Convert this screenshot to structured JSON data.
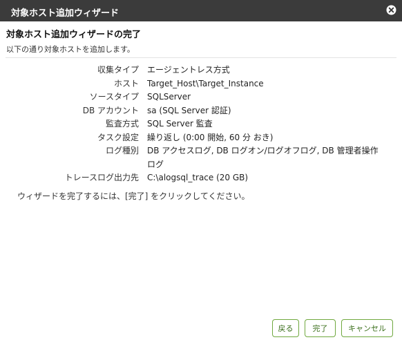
{
  "window": {
    "title": "対象ホスト追加ウィザード",
    "close_icon": "close-icon"
  },
  "content": {
    "heading": "対象ホスト追加ウィザードの完了",
    "subtext": "以下の通り対象ホストを追加します。",
    "summary": [
      {
        "label": "収集タイプ",
        "value": "エージェントレス方式"
      },
      {
        "label": "ホスト",
        "value": "Target_Host\\Target_Instance"
      },
      {
        "label": "ソースタイプ",
        "value": "SQLServer"
      },
      {
        "label": "DB アカウント",
        "value": "sa (SQL Server 認証)"
      },
      {
        "label": "監査方式",
        "value": "SQL Server 監査"
      },
      {
        "label": "タスク設定",
        "value": "繰り返し (0:00 開始, 60 分 おき)"
      },
      {
        "label": "ログ種別",
        "value": "DB アクセスログ, DB ログオン/ログオフログ, DB 管理者操作ログ"
      },
      {
        "label": "トレースログ出力先",
        "value": "C:\\alogsql_trace (20 GB)"
      }
    ],
    "instruction": "ウィザードを完了するには、[完了] をクリックしてください。"
  },
  "footer": {
    "back_label": "戻る",
    "finish_label": "完了",
    "cancel_label": "キャンセル"
  },
  "colors": {
    "titlebar": "#3b3b3b",
    "button_border": "#6fa83e",
    "button_text": "#3a6e1a"
  }
}
